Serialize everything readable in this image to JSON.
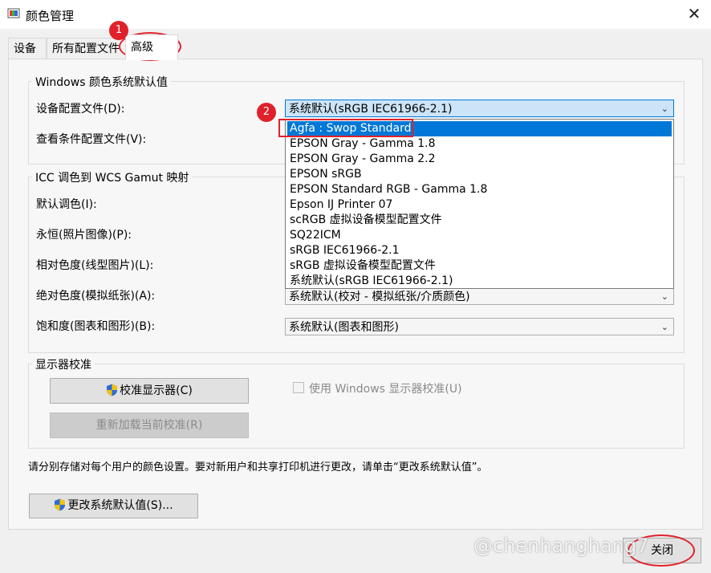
{
  "window": {
    "title": "颜色管理",
    "close_glyph": "✕"
  },
  "tabs": [
    {
      "label": "设备"
    },
    {
      "label": "所有配置文件"
    },
    {
      "label": "高级"
    }
  ],
  "windows_defaults": {
    "title": "Windows 颜色系统默认值",
    "device_profile_label": "设备配置文件(D):",
    "device_profile_value": "系统默认(sRGB IEC61966-2.1)",
    "viewing_conditions_label": "查看条件配置文件(V):"
  },
  "dropdown_items": [
    "Agfa : Swop Standard",
    "EPSON  Gray - Gamma 1.8",
    "EPSON  Gray - Gamma 2.2",
    "EPSON  sRGB",
    "EPSON  Standard RGB - Gamma 1.8",
    "Epson IJ Printer 07",
    "scRGB 虚拟设备模型配置文件",
    "SQ22ICM",
    "sRGB IEC61966-2.1",
    "sRGB 虚拟设备模型配置文件",
    "系统默认(sRGB IEC61966-2.1)"
  ],
  "icc_mapping": {
    "title": "ICC 调色到 WCS Gamut 映射",
    "default_label": "默认调色(I):",
    "perceptual_label": "永恒(照片图像)(P):",
    "relative_label": "相对色度(线型图片)(L):",
    "absolute_label": "绝对色度(模拟纸张)(A):",
    "absolute_value": "系统默认(校对 - 模拟纸张/介质颜色)",
    "saturation_label": "饱和度(图表和图形)(B):",
    "saturation_value": "系统默认(图表和图形)"
  },
  "calibration": {
    "title": "显示器校准",
    "calibrate_button": "校准显示器(C)",
    "reload_button": "重新加载当前校准(R)",
    "use_windows_checkbox": "使用 Windows 显示器校准(U)"
  },
  "footer": {
    "note": "请分别存储对每个用户的颜色设置。要对新用户和共享打印机进行更改，请单击“更改系统默认值”。",
    "change_defaults_button": "更改系统默认值(S)...",
    "close_button": "关闭"
  },
  "annotations": {
    "step1": "1",
    "step2": "2"
  },
  "watermark": "@chenhanghang7",
  "colors": {
    "accent": "#0078d7",
    "annotation_red": "#e0212b"
  }
}
